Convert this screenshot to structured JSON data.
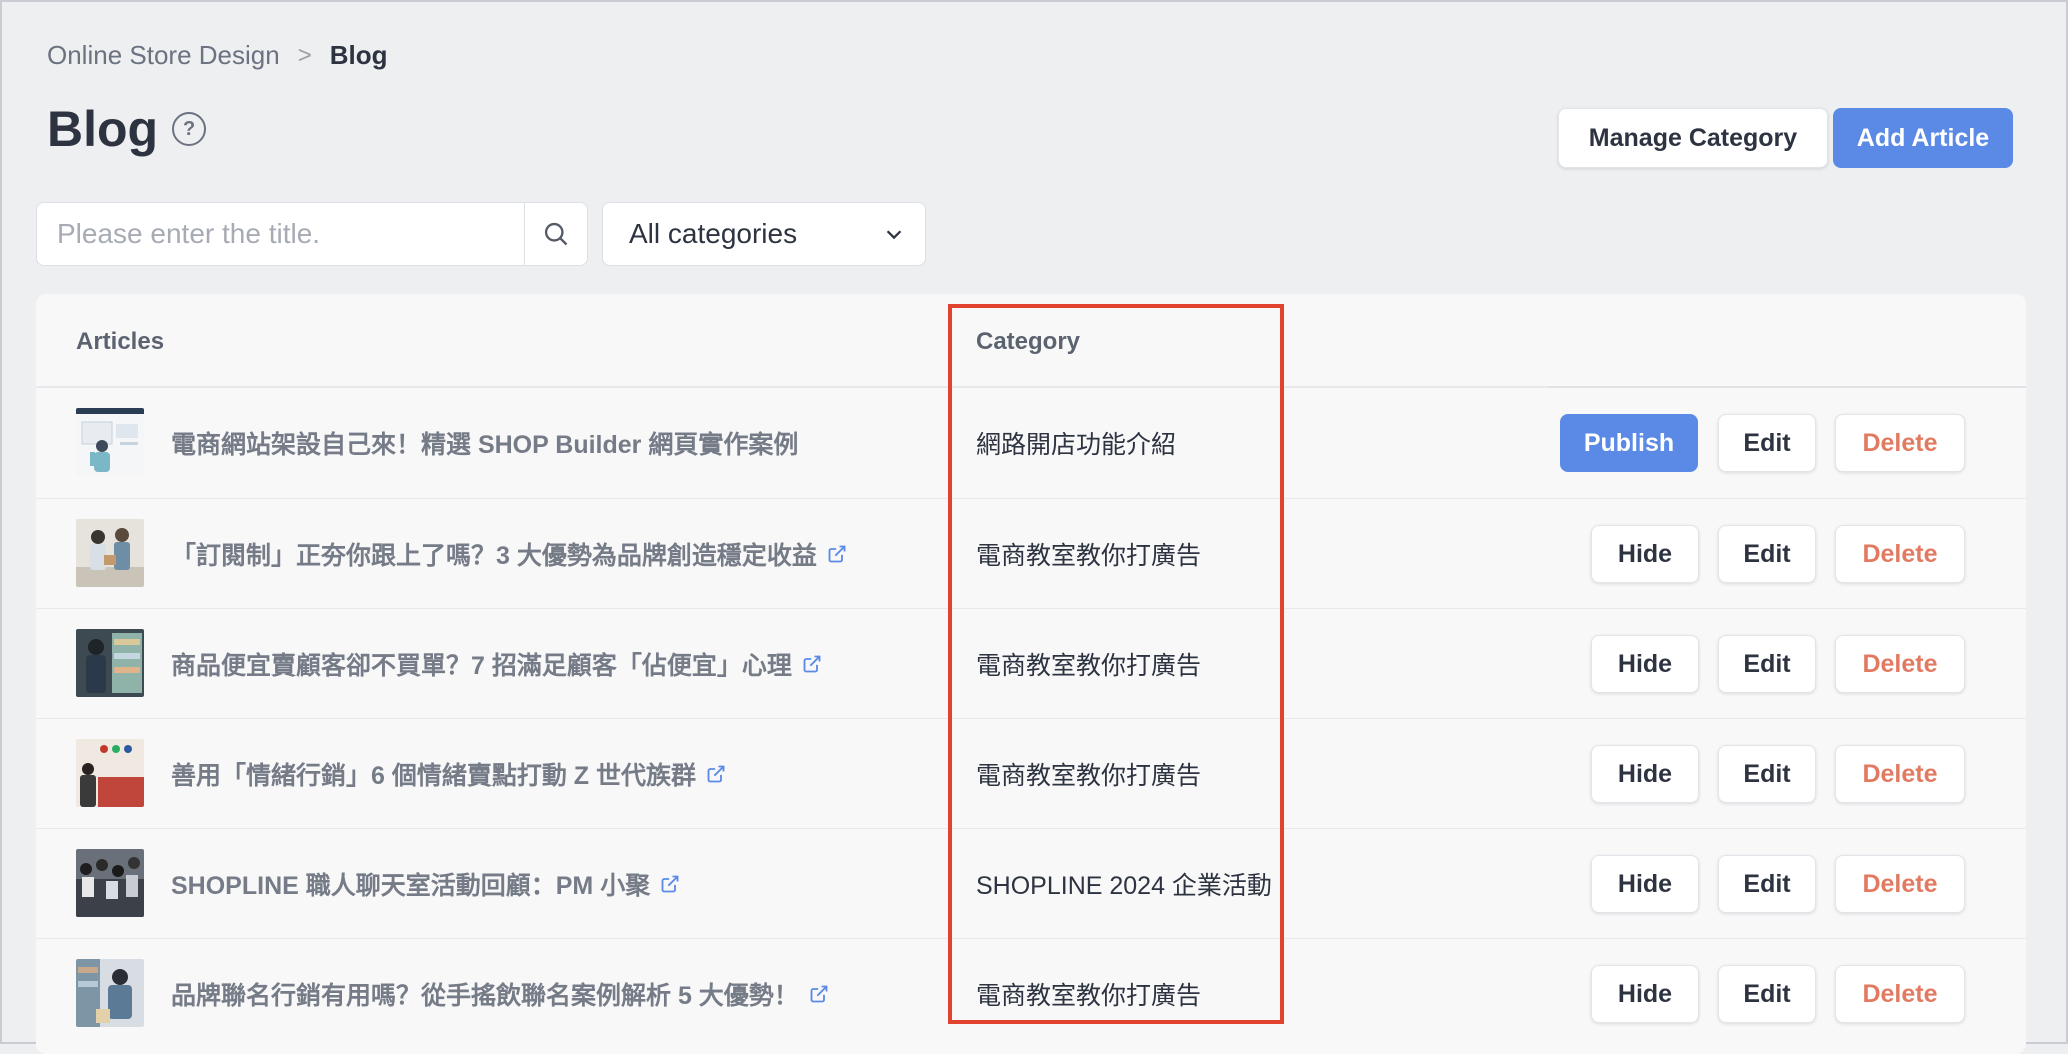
{
  "breadcrumb": {
    "parent": "Online Store Design",
    "separator": ">",
    "current": "Blog"
  },
  "page": {
    "title": "Blog"
  },
  "header_buttons": {
    "manage_category": "Manage Category",
    "add_article": "Add Article"
  },
  "search": {
    "placeholder": "Please enter the title.",
    "value": ""
  },
  "category_filter": {
    "selected": "All categories"
  },
  "table": {
    "columns": {
      "articles": "Articles",
      "category": "Category"
    },
    "rows": [
      {
        "title": "電商網站架設自己來！精選 SHOP Builder 網頁實作案例",
        "category": "網路開店功能介紹",
        "primary_action": "Publish",
        "external_link": false
      },
      {
        "title": "「訂閱制」正夯你跟上了嗎？3 大優勢為品牌創造穩定收益",
        "category": "電商教室教你打廣告",
        "primary_action": "Hide",
        "external_link": true
      },
      {
        "title": "商品便宜賣顧客卻不買單？7 招滿足顧客「佔便宜」心理",
        "category": "電商教室教你打廣告",
        "primary_action": "Hide",
        "external_link": true
      },
      {
        "title": "善用「情緒行銷」6 個情緒賣點打動 Z 世代族群",
        "category": "電商教室教你打廣告",
        "primary_action": "Hide",
        "external_link": true
      },
      {
        "title": "SHOPLINE 職人聊天室活動回顧：PM 小聚",
        "category": "SHOPLINE 2024 企業活動",
        "primary_action": "Hide",
        "external_link": true
      },
      {
        "title": "品牌聯名行銷有用嗎？從手搖飲聯名案例解析 5 大優勢！",
        "category": "電商教室教你打廣告",
        "primary_action": "Hide",
        "external_link": true
      }
    ],
    "row_actions": {
      "edit": "Edit",
      "delete": "Delete"
    }
  },
  "colors": {
    "accent": "#5b8ae6",
    "delete": "#e27a62",
    "highlight": "#e2432f",
    "background": "#eeeff1"
  },
  "icons": {
    "help": "help-circle-icon",
    "search": "search-icon",
    "dropdown": "chevron-down-icon",
    "external": "external-link-icon"
  }
}
